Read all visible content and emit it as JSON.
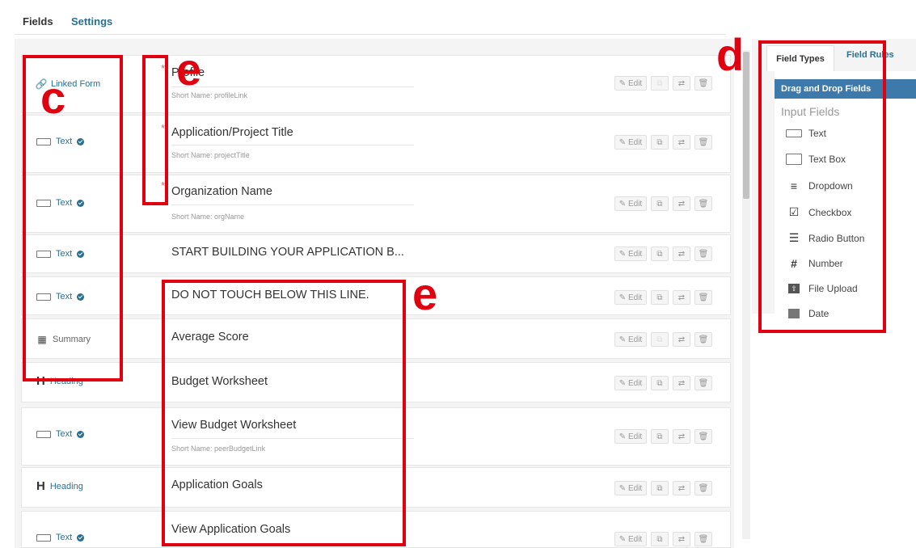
{
  "tabs": {
    "fields": "Fields",
    "settings": "Settings"
  },
  "fields": [
    {
      "type_label": "Linked Form",
      "type_icon": "link-icon",
      "title": "Profile",
      "short_name": "Short Name: profileLink",
      "required": true,
      "duplicate_enabled": false
    },
    {
      "type_label": "Text",
      "type_icon": "textbox-icon",
      "title": "Application/Project Title",
      "short_name": "Short Name: projectTitle",
      "required": true,
      "duplicate_enabled": true
    },
    {
      "type_label": "Text",
      "type_icon": "textbox-icon",
      "title": "Organization Name",
      "short_name": "Short Name: orgName",
      "required": true,
      "duplicate_enabled": true
    },
    {
      "type_label": "Text",
      "type_icon": "textbox-icon",
      "title": "START BUILDING YOUR APPLICATION B...",
      "short_name": "",
      "required": false,
      "duplicate_enabled": true
    },
    {
      "type_label": "Text",
      "type_icon": "textbox-icon",
      "title": "DO NOT TOUCH BELOW THIS LINE.",
      "short_name": "",
      "required": false,
      "duplicate_enabled": true
    },
    {
      "type_label": "Summary",
      "type_icon": "table-icon",
      "title": "Average Score",
      "short_name": "",
      "required": false,
      "duplicate_enabled": false
    },
    {
      "type_label": "Heading",
      "type_icon": "heading-icon",
      "title": "Budget Worksheet",
      "short_name": "",
      "required": false,
      "duplicate_enabled": true
    },
    {
      "type_label": "Text",
      "type_icon": "textbox-icon",
      "title": "View Budget Worksheet",
      "short_name": "Short Name: peerBudgetLink",
      "required": false,
      "duplicate_enabled": true
    },
    {
      "type_label": "Heading",
      "type_icon": "heading-icon",
      "title": "Application Goals",
      "short_name": "",
      "required": false,
      "duplicate_enabled": true
    },
    {
      "type_label": "Text",
      "type_icon": "textbox-icon",
      "title": "View Application Goals",
      "short_name": "",
      "required": false,
      "duplicate_enabled": true
    }
  ],
  "actions": {
    "edit": "Edit",
    "edit_icon": "pencil-icon",
    "duplicate_icon": "copy-icon",
    "move_icon": "shuffle-icon",
    "delete_icon": "trash-icon"
  },
  "right_panel": {
    "tab_field_types": "Field Types",
    "tab_field_rules": "Field Rules",
    "section_header": "Drag and Drop Fields",
    "group_label": "Input Fields",
    "items": [
      {
        "label": "Text",
        "icon": "textbox-icon"
      },
      {
        "label": "Text Box",
        "icon": "textarea-icon"
      },
      {
        "label": "Dropdown",
        "icon": "dropdown-icon"
      },
      {
        "label": "Checkbox",
        "icon": "checkbox-icon"
      },
      {
        "label": "Radio Button",
        "icon": "list-icon"
      },
      {
        "label": "Number",
        "icon": "hash-icon"
      },
      {
        "label": "File Upload",
        "icon": "upload-icon"
      },
      {
        "label": "Date",
        "icon": "calendar-icon"
      }
    ]
  },
  "annotations": {
    "c": "c",
    "d": "d",
    "e1": "e",
    "e2": "e"
  },
  "colors": {
    "accent": "#2a6f93",
    "panel_header": "#3d7aab",
    "annotation": "#e0000f",
    "required": "#d06a6a"
  }
}
